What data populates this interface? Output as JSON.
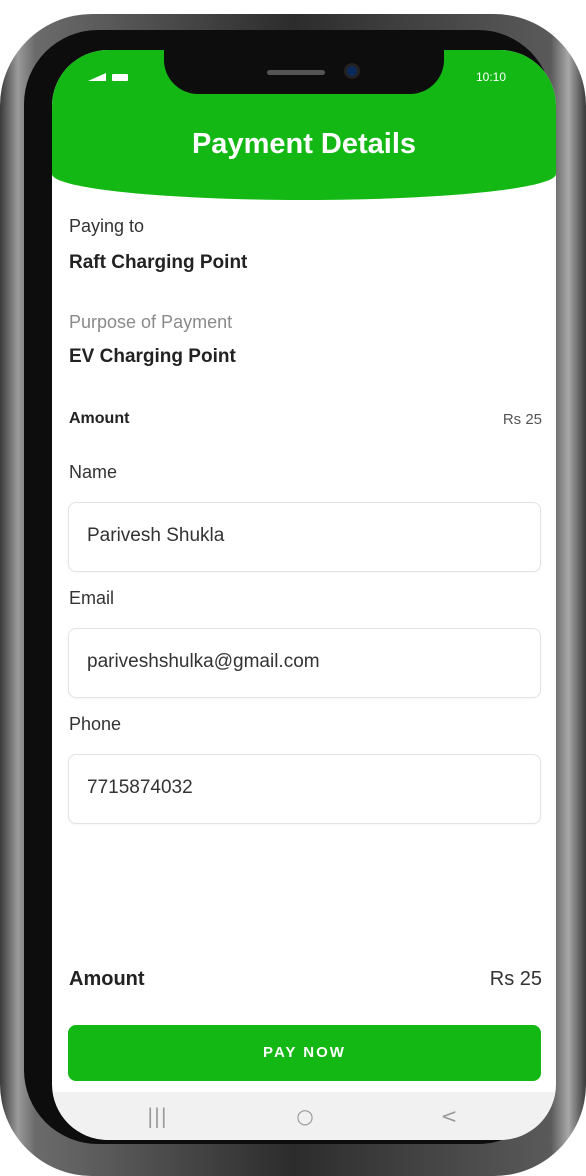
{
  "status": {
    "time": "10:10"
  },
  "header": {
    "title": "Payment Details"
  },
  "payee": {
    "label": "Paying to",
    "value": "Raft Charging Point"
  },
  "purpose": {
    "label": "Purpose of Payment",
    "value": "EV Charging Point"
  },
  "amount_top": {
    "label": "Amount",
    "value": "Rs 25"
  },
  "form": {
    "name": {
      "label": "Name",
      "value": "Parivesh Shukla"
    },
    "email": {
      "label": "Email",
      "value": "pariveshshulka@gmail.com"
    },
    "phone": {
      "label": "Phone",
      "value": "7715874032"
    }
  },
  "amount_bottom": {
    "label": "Amount",
    "value": "Rs 25"
  },
  "pay_button": {
    "label": "PAY NOW"
  },
  "navbar": {
    "recents": "|||",
    "home": "○",
    "back": "<"
  },
  "colors": {
    "accent": "#14b814"
  },
  "icons": [
    "signal-icon",
    "battery-icon",
    "recents-icon",
    "home-icon",
    "back-icon"
  ]
}
